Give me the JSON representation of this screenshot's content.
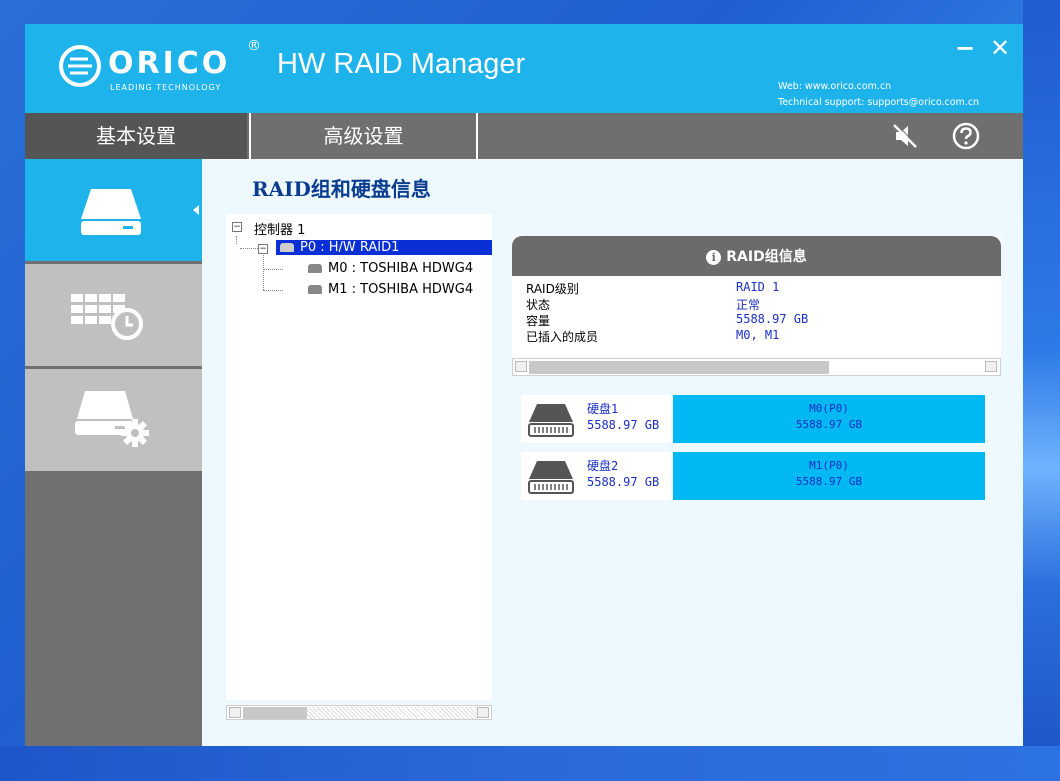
{
  "header": {
    "logo_text": "ORICO",
    "logo_sub": "LEADING TECHNOLOGY",
    "logo_reg": "®",
    "app_title": "HW RAID Manager",
    "minimize": "−",
    "close": "✕",
    "web": "Web: www.orico.com.cn",
    "support": "Technical support: supports@orico.com.cn"
  },
  "tabs": {
    "basic": "基本设置",
    "advanced": "高级设置"
  },
  "toolbar": {
    "mute_icon": "speaker-muted-icon",
    "help_icon": "help-icon"
  },
  "sidebar": {
    "items": [
      {
        "icon": "hard-drive-icon"
      },
      {
        "icon": "table-clock-icon"
      },
      {
        "icon": "drive-settings-icon"
      }
    ]
  },
  "content": {
    "title": "RAID组和硬盘信息",
    "tree": {
      "controller": "控制器 1",
      "raid": "P0 : H/W RAID1",
      "members": [
        "M0 : TOSHIBA HDWG4",
        "M1 : TOSHIBA HDWG4"
      ]
    },
    "raid_info": {
      "title": "RAID组信息",
      "rows": [
        {
          "label": "RAID级别",
          "value": "RAID 1"
        },
        {
          "label": "状态",
          "value": "正常"
        },
        {
          "label": "容量",
          "value": "5588.97 GB"
        },
        {
          "label": "已插入的成员",
          "value": "M0, M1"
        }
      ]
    },
    "disks": [
      {
        "name": "硬盘1",
        "size": "5588.97 GB",
        "member": "M0(P0)",
        "member_size": "5588.97 GB"
      },
      {
        "name": "硬盘2",
        "size": "5588.97 GB",
        "member": "M1(P0)",
        "member_size": "5588.97 GB"
      }
    ]
  },
  "colors": {
    "accent": "#1fb3ec",
    "tab_dark": "#555555",
    "panel_head": "#6b6b6b",
    "link_text": "#1a2fc4"
  }
}
